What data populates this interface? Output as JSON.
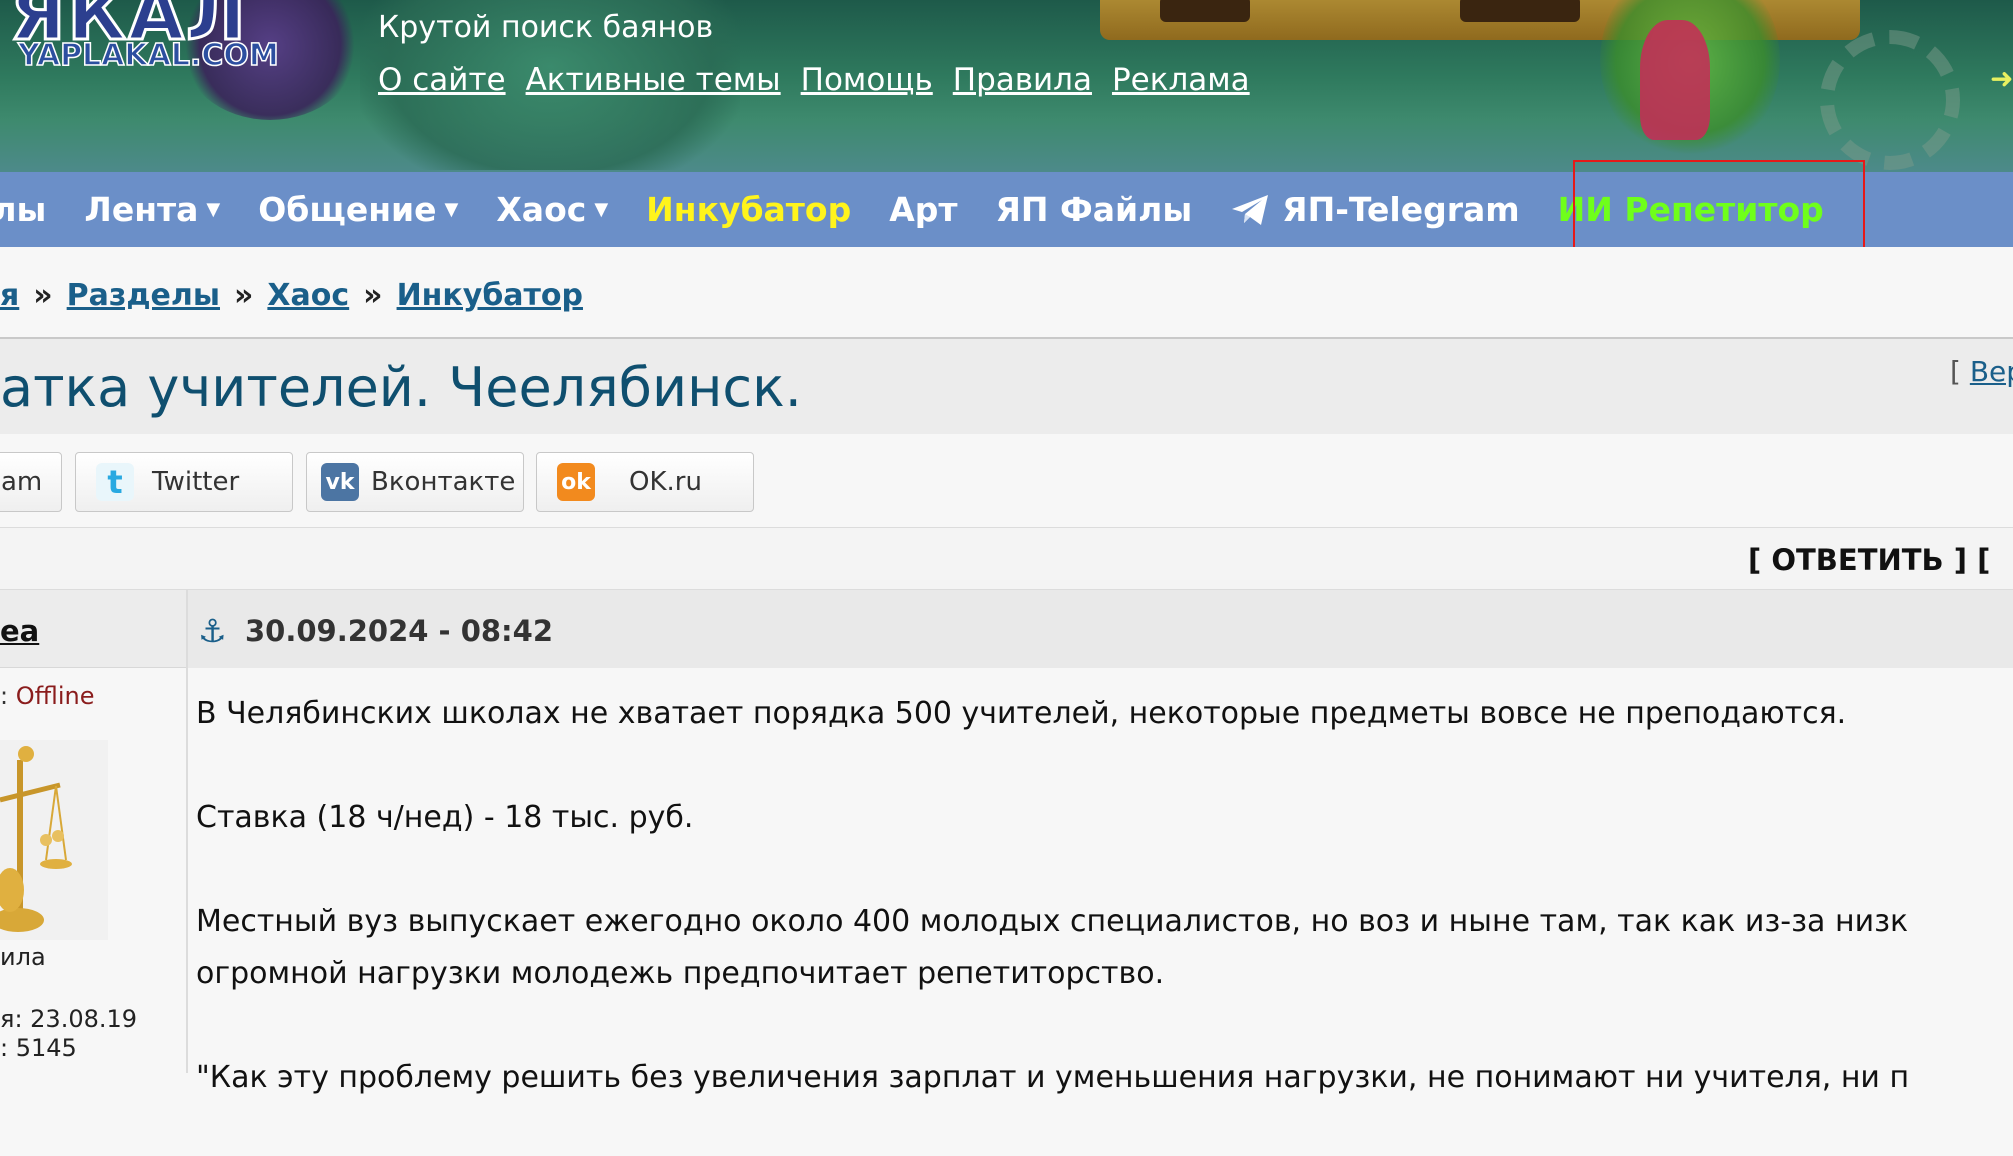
{
  "header": {
    "logo_text": "ЯКАЛ",
    "logo_domain": "YAPLAKAL.COM",
    "tagline": "Крутой поиск баянов",
    "links": [
      "О сайте",
      "Активные темы",
      "Помощь",
      "Правила",
      "Реклама"
    ]
  },
  "nav": {
    "items": [
      {
        "label": "елы"
      },
      {
        "label": "Лента"
      },
      {
        "label": "Общение"
      },
      {
        "label": "Хаос"
      },
      {
        "label": "Инкубатор"
      },
      {
        "label": "Арт"
      },
      {
        "label": "ЯП Файлы"
      },
      {
        "label": "ЯП-Telegram"
      },
      {
        "label": "ИИ Репетитор"
      }
    ],
    "colors": {
      "bar": "#6b8fc8",
      "highlight_yellow": "#fff41c",
      "highlight_green": "#6fff1a",
      "annotation_red": "#e61919"
    }
  },
  "breadcrumb": {
    "items": [
      "я",
      "Разделы",
      "Хаос",
      "Инкубатор"
    ],
    "separator": "»"
  },
  "title": {
    "text": "атка учителей. Чеелябинск.",
    "version_prefix": "[",
    "version_link": "Вер"
  },
  "share": {
    "buttons": [
      {
        "label": "am"
      },
      {
        "label": "Twitter"
      },
      {
        "label": "Вконтакте"
      },
      {
        "label": "OK.ru"
      }
    ]
  },
  "reply": {
    "label": "[ ОТВЕТИТЬ ] ["
  },
  "post": {
    "author": "ea",
    "date": "30.09.2024 - 08:42",
    "status_prefix": ":",
    "status": "Offline",
    "rank": "ила",
    "registered": "я: 23.08.19",
    "posts": ": 5145",
    "paragraphs": [
      "В Челябинских школах не хватает порядка 500 учителей, некоторые предметы вовсе не преподаются.",
      "Ставка (18 ч/нед) - 18 тыс. руб.",
      "Местный вуз выпускает ежегодно около 400 молодых специалистов, но воз и ныне там, так как из-за низк",
      "\"Как эту проблему решить без увеличения зарплат и уменьшения нагрузки, не понимают ни учителя, ни п"
    ],
    "paragraph_3_line2": "огромной нагрузки молодежь предпочитает репетиторство."
  }
}
